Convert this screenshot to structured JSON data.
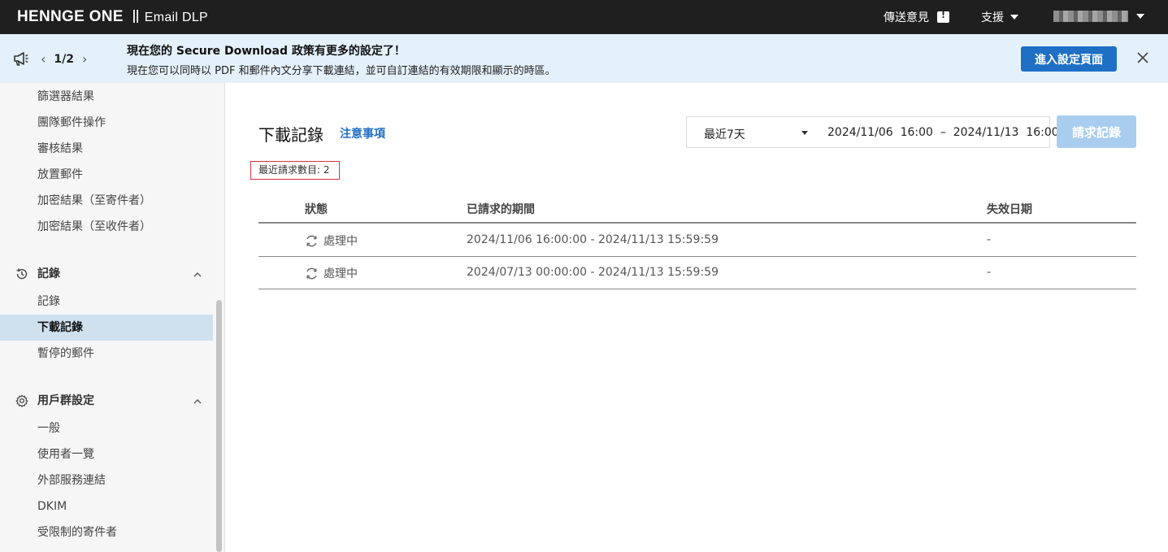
{
  "topbar": {
    "brand": "HENNGE One",
    "product": "Email DLP",
    "feedback_label": "傳送意見",
    "support_label": "支援"
  },
  "announcement": {
    "pager": "1/2",
    "title": "現在您的 Secure Download 政策有更多的設定了！",
    "body": "現在您可以同時以 PDF 和郵件內文分享下載連結，並可自訂連結的有效期限和顯示的時區。",
    "button_label": "進入設定頁面"
  },
  "sidebar": {
    "items_top": [
      {
        "label": "篩選器結果"
      },
      {
        "label": "團隊郵件操作"
      },
      {
        "label": "審核結果"
      },
      {
        "label": "放置郵件"
      },
      {
        "label": "加密結果（至寄件者）"
      },
      {
        "label": "加密結果（至收件者）"
      }
    ],
    "records_section": {
      "title": "記錄",
      "items": [
        {
          "label": "記錄"
        },
        {
          "label": "下載記錄"
        },
        {
          "label": "暫停的郵件"
        }
      ]
    },
    "group_section": {
      "title": "用戶群設定",
      "items": [
        {
          "label": "一般"
        },
        {
          "label": "使用者一覽"
        },
        {
          "label": "外部服務連結"
        },
        {
          "label": "DKIM"
        },
        {
          "label": "受限制的寄件者"
        }
      ]
    }
  },
  "main": {
    "title": "下載記錄",
    "notes_link": "注意事項",
    "range_option": "最近7天",
    "range_text": "2024/11/06  16:00  –  2024/11/13  16:00",
    "request_button": "請求記錄",
    "recent_count": "最近請求數目: 2",
    "table": {
      "headers": [
        "狀態",
        "已請求的期間",
        "失效日期"
      ],
      "rows": [
        {
          "status": "處理中",
          "period": "2024/11/06 16:00:00 - 2024/11/13 15:59:59",
          "expiry": "-"
        },
        {
          "status": "處理中",
          "period": "2024/07/13 00:00:00 - 2024/11/13 15:59:59",
          "expiry": "-"
        }
      ]
    }
  },
  "colors": {
    "topbar_bg": "#1f1f1f",
    "announce_bg": "#e4f1fb",
    "primary": "#1f70c4",
    "link": "#1f6ec2",
    "disabled_button": "#a9cdee",
    "active_nav": "#cfe0ef",
    "highlight_border": "#d9333f"
  }
}
